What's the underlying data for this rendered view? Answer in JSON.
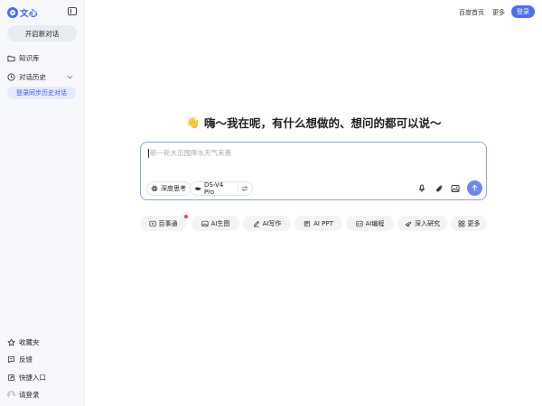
{
  "sidebar": {
    "logo_text": "文心",
    "new_chat_label": "开启新对话",
    "items": [
      {
        "label": "知识库",
        "icon": "folder-icon"
      },
      {
        "label": "对话历史",
        "icon": "clock-icon"
      }
    ],
    "login_sync_label": "登录同步历史对话",
    "bottom_items": [
      {
        "label": "收藏夹",
        "icon": "star-icon"
      },
      {
        "label": "反馈",
        "icon": "feedback-icon"
      },
      {
        "label": "快捷入口",
        "icon": "shortcut-icon"
      },
      {
        "label": "请登录",
        "icon": "avatar"
      }
    ]
  },
  "header": {
    "links": [
      "百度首页",
      "更多"
    ],
    "login_label": "登录"
  },
  "main": {
    "greeting_emoji": "👋",
    "greeting": "嗨～我在呢，有什么想做的、想问的都可以说～",
    "input": {
      "placeholder": "新一轮大范围降水天气来袭",
      "deep_think_label": "深度思考",
      "model_label": "DS-V4 Pro"
    },
    "chips": [
      {
        "label": "百事通",
        "icon": "play-icon",
        "has_dot": true
      },
      {
        "label": "AI生图",
        "icon": "image-icon"
      },
      {
        "label": "AI写作",
        "icon": "pen-icon"
      },
      {
        "label": "AI PPT",
        "icon": "ppt-icon"
      },
      {
        "label": "AI编程",
        "icon": "code-icon"
      },
      {
        "label": "深入研究",
        "icon": "telescope-icon"
      },
      {
        "label": "更多",
        "icon": "grid-icon"
      }
    ]
  },
  "colors": {
    "accent": "#4e6ef2",
    "sidebar_bg": "#f7f8fc",
    "chip_bg": "#f3f4f7",
    "dot": "#f23a3a"
  }
}
